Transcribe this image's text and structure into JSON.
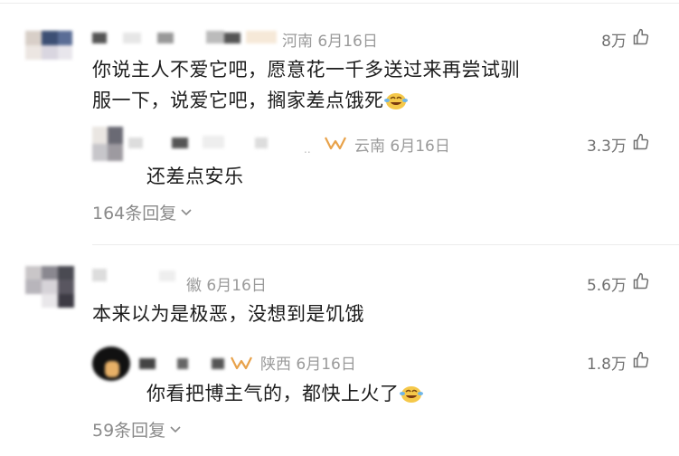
{
  "comments": [
    {
      "location_date": "河南 6月16日",
      "likes": "8万",
      "text_line1": "你说主人不爱它吧，愿意花一千多送过来再尝试驯",
      "text_line2": "服一下，说爱它吧，搁家差点饿死",
      "reply": {
        "location_date": "云南 6月16日",
        "likes": "3.3万",
        "text": "还差点安乐"
      },
      "reply_count": "164条回复"
    },
    {
      "location_date": "徽 6月16日",
      "likes": "5.6万",
      "text": "本来以为是极恶，没想到是饥饿",
      "reply": {
        "location_date": "陕西 6月16日",
        "likes": "1.8万",
        "text": "你看把博主气的，都快上火了"
      },
      "reply_count": "59条回复"
    }
  ],
  "colors": {
    "badge_orange": "#e8a24a",
    "text": "#1c1c1c",
    "meta": "#9a9a9a"
  }
}
